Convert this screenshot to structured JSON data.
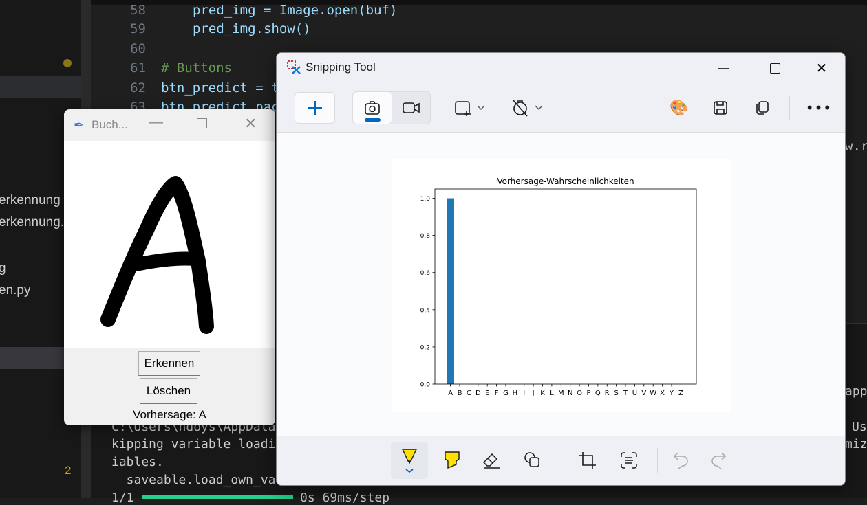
{
  "sidebar": {
    "items": [
      "erkennung",
      "erkennung.",
      "g",
      "en.py"
    ],
    "badge": "2"
  },
  "editor": {
    "lines": [
      {
        "num": "58",
        "code": "pred_img = Image.open(buf)"
      },
      {
        "num": "59",
        "code": "pred_img.show()"
      },
      {
        "num": "60",
        "code": ""
      },
      {
        "num": "61",
        "code": "# Buttons"
      },
      {
        "num": "62",
        "code": "btn_predict = t"
      },
      {
        "num": "63",
        "code": "btn_predict.pac"
      }
    ],
    "right_fragment": "w.r"
  },
  "terminal": {
    "lines": [
      "C:\\Users\\ndoys\\AppData",
      "kipping variable loadi",
      "iables.",
      "  saveable.load_own_va",
      "1/1"
    ],
    "right_fragments": [
      "app",
      "Us",
      "miz"
    ],
    "step_text": "0s 69ms/step",
    "progress": 1.0
  },
  "tk_window": {
    "title": "Buch...",
    "buttons": {
      "recognize": "Erkennen",
      "clear": "Löschen"
    },
    "prediction": "Vorhersage: A"
  },
  "snipping_tool": {
    "title": "Snipping Tool",
    "accent": "#0067c0"
  },
  "chart_data": {
    "type": "bar",
    "title": "Vorhersage-Wahrscheinlichkeiten",
    "categories": [
      "A",
      "B",
      "C",
      "D",
      "E",
      "F",
      "G",
      "H",
      "I",
      "J",
      "K",
      "L",
      "M",
      "N",
      "O",
      "P",
      "Q",
      "R",
      "S",
      "T",
      "U",
      "V",
      "W",
      "X",
      "Y",
      "Z"
    ],
    "values": [
      1.0,
      0,
      0,
      0,
      0,
      0,
      0,
      0,
      0,
      0,
      0,
      0,
      0,
      0,
      0,
      0,
      0,
      0,
      0,
      0,
      0,
      0,
      0,
      0,
      0,
      0
    ],
    "yticks": [
      "0.0",
      "0.2",
      "0.4",
      "0.6",
      "0.8",
      "1.0"
    ],
    "ylim": [
      0,
      1.05
    ],
    "xlabel": "",
    "ylabel": "",
    "color": "#1f77b4"
  }
}
